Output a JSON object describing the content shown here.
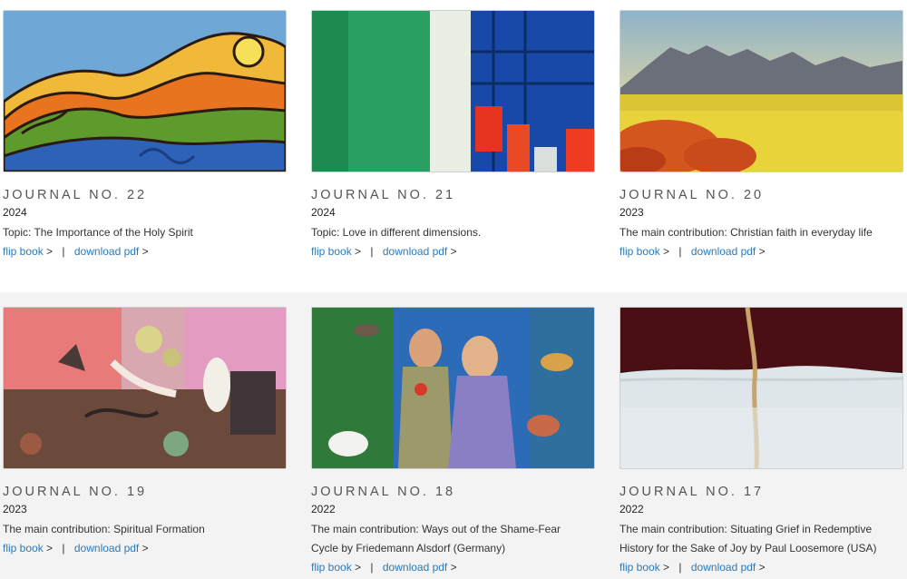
{
  "journals": [
    {
      "title": "JOURNAL NO. 22",
      "year": "2024",
      "topic": "Topic: The Importance of the Holy Spirit",
      "flip_label": "flip book",
      "download_label": "download pdf",
      "arrow": ">",
      "separator": "|",
      "image": "abstract-landscape-painting"
    },
    {
      "title": "JOURNAL NO. 21",
      "year": "2024",
      "topic": "Topic: Love in different dimensions.",
      "flip_label": "flip book",
      "download_label": "download pdf",
      "arrow": ">",
      "separator": "|",
      "image": "abstract-green-blue-red-painting"
    },
    {
      "title": "JOURNAL NO. 20",
      "year": "2023",
      "topic": "The main contribution: Christian faith in everyday life",
      "flip_label": "flip book",
      "download_label": "download pdf",
      "arrow": ">",
      "separator": "|",
      "image": "mountain-field-photo"
    },
    {
      "title": "JOURNAL NO. 19",
      "year": "2023",
      "topic": "The main contribution: Spiritual Formation",
      "flip_label": "flip book",
      "download_label": "download pdf",
      "arrow": ">",
      "separator": "|",
      "image": "surreal-collage-painting"
    },
    {
      "title": "JOURNAL NO. 18",
      "year": "2022",
      "topic": "The main contribution: Ways out of the Shame-Fear Cycle by Friedemann Alsdorf (Germany)",
      "flip_label": "flip book",
      "download_label": "download pdf",
      "arrow": ">",
      "separator": "|",
      "image": "adam-and-eve-painting"
    },
    {
      "title": "JOURNAL NO. 17",
      "year": "2022",
      "topic": "The main contribution: Situating Grief in Redemptive History for the Sake of Joy by Paul Loosemore (USA)",
      "flip_label": "flip book",
      "download_label": "download pdf",
      "arrow": ">",
      "separator": "|",
      "image": "cracked-white-dark-red-painting"
    }
  ],
  "colors": {
    "link": "#2a7ab8",
    "bottom_band": "#f3f3f3"
  }
}
